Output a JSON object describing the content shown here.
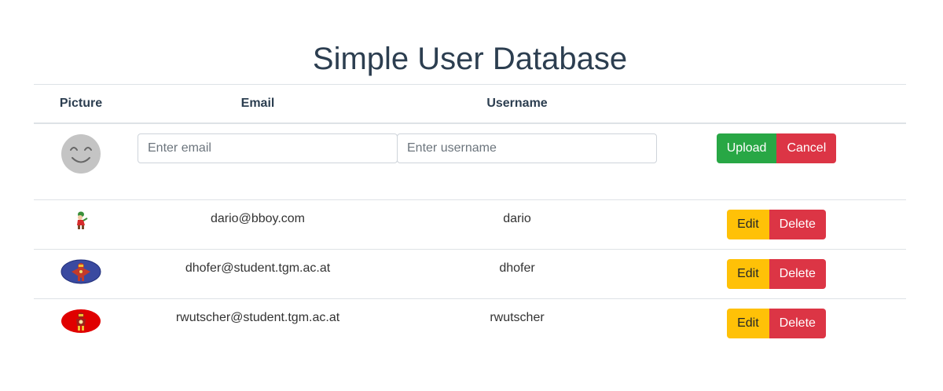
{
  "page": {
    "title": "Simple User Database"
  },
  "table": {
    "headers": {
      "picture": "Picture",
      "email": "Email",
      "username": "Username",
      "actions": ""
    },
    "new_user": {
      "email_placeholder": "Enter email",
      "email_value": "",
      "username_placeholder": "Enter username",
      "username_value": "",
      "upload_label": "Upload",
      "cancel_label": "Cancel",
      "avatar_icon": "smiley-face-icon"
    },
    "rows": [
      {
        "email": "dario@bboy.com",
        "username": "dario",
        "edit_label": "Edit",
        "delete_label": "Delete",
        "avatar_icon": "cartoon-figure-icon"
      },
      {
        "email": "dhofer@student.tgm.ac.at",
        "username": "dhofer",
        "edit_label": "Edit",
        "delete_label": "Delete",
        "avatar_icon": "ironman-on-blue-icon"
      },
      {
        "email": "rwutscher@student.tgm.ac.at",
        "username": "rwutscher",
        "edit_label": "Edit",
        "delete_label": "Delete",
        "avatar_icon": "ironman-on-red-icon"
      }
    ]
  },
  "colors": {
    "success": "#28a745",
    "danger": "#dc3545",
    "warning": "#ffc107",
    "title": "#2c3e50"
  }
}
